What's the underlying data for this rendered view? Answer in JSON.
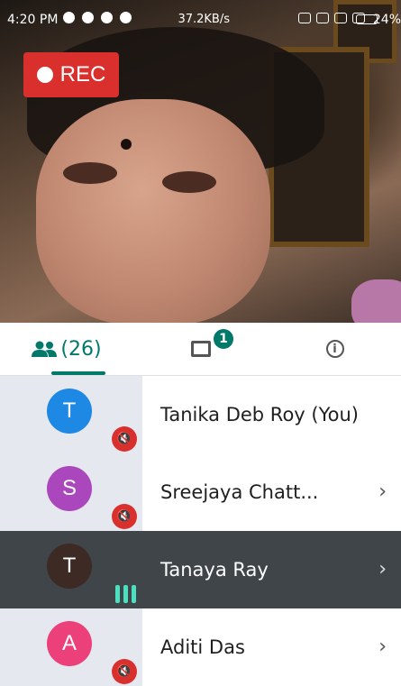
{
  "status_bar": {
    "time": "4:20 PM",
    "speed": "37.2KB/s",
    "battery": "24%"
  },
  "recording": {
    "label": "REC"
  },
  "tabs": {
    "people_count": "(26)",
    "chat_badge": "1"
  },
  "participants": [
    {
      "initial": "T",
      "name": "Tanika Deb Roy (You)",
      "avatar_color": "#1e88e5",
      "muted": true,
      "speaking": false,
      "chevron": false
    },
    {
      "initial": "S",
      "name": "Sreejaya Chatt...",
      "avatar_color": "#ab47bc",
      "muted": true,
      "speaking": false,
      "chevron": true
    },
    {
      "initial": "T",
      "name": "Tanaya Ray",
      "avatar_color": "#3e2a24",
      "muted": false,
      "speaking": true,
      "chevron": true
    },
    {
      "initial": "A",
      "name": "Aditi Das",
      "avatar_color": "#ec407a",
      "muted": true,
      "speaking": false,
      "chevron": true
    }
  ],
  "colors": {
    "accent": "#00796b",
    "mute_red": "#d9302e",
    "speaking_green": "#4be0c0"
  }
}
